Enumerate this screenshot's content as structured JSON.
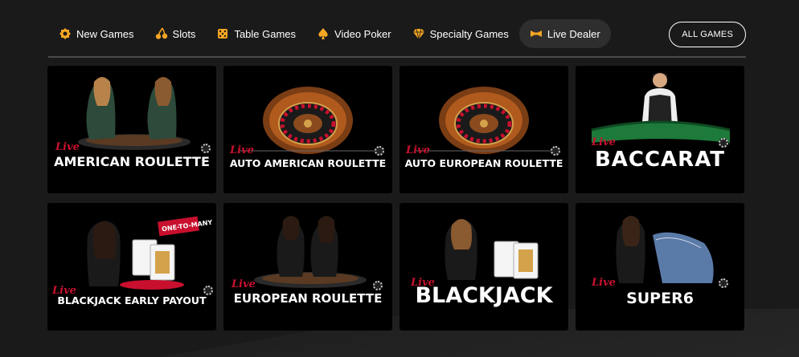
{
  "nav": {
    "tabs": [
      {
        "label": "New Games",
        "icon": "new-games-icon",
        "color": "#f5a623"
      },
      {
        "label": "Slots",
        "icon": "cherries-icon",
        "color": "#f5a623"
      },
      {
        "label": "Table Games",
        "icon": "dice-icon",
        "color": "#f5a623"
      },
      {
        "label": "Video Poker",
        "icon": "spade-icon",
        "color": "#f5a623"
      },
      {
        "label": "Specialty Games",
        "icon": "diamond-icon",
        "color": "#f5a623"
      },
      {
        "label": "Live Dealer",
        "icon": "bowtie-icon",
        "color": "#f5a623",
        "active": true
      }
    ],
    "all_games_label": "ALL GAMES"
  },
  "games": [
    {
      "live": "Live",
      "title": "AMERICAN ROULETTE"
    },
    {
      "live": "Live",
      "title": "AUTO AMERICAN ROULETTE"
    },
    {
      "live": "Live",
      "title": "AUTO EUROPEAN ROULETTE"
    },
    {
      "live": "Live",
      "title": "BACCARAT"
    },
    {
      "live": "Live",
      "title": "BLACKJACK EARLY PAYOUT",
      "badge": "ONE-TO-MANY"
    },
    {
      "live": "Live",
      "title": "EUROPEAN ROULETTE"
    },
    {
      "live": "Live",
      "title": "BLACKJACK"
    },
    {
      "live": "Live",
      "title": "SUPER6"
    }
  ],
  "colors": {
    "accent": "#f5a623",
    "live_red": "#c8102e",
    "background": "#1a1a1a",
    "card": "#000000"
  }
}
